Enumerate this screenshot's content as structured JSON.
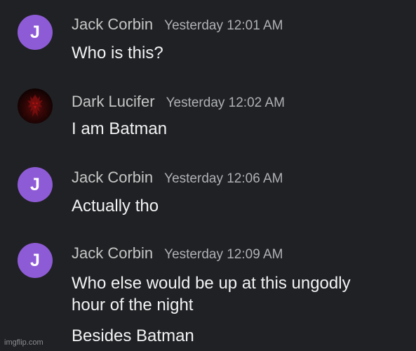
{
  "messages": [
    {
      "avatar_letter": "J",
      "avatar_color": "#8e5bd6",
      "name": "Jack Corbin",
      "time": "Yesterday 12:01 AM",
      "lines": [
        "Who is this?"
      ]
    },
    {
      "avatar_icon": "demon-figure-icon",
      "name": "Dark Lucifer",
      "time": "Yesterday 12:02 AM",
      "lines": [
        "I am Batman"
      ]
    },
    {
      "avatar_letter": "J",
      "avatar_color": "#8e5bd6",
      "name": "Jack Corbin",
      "time": "Yesterday 12:06 AM",
      "lines": [
        "Actually tho"
      ]
    },
    {
      "avatar_letter": "J",
      "avatar_color": "#8e5bd6",
      "name": "Jack Corbin",
      "time": "Yesterday 12:09 AM",
      "lines": [
        "Who else would be up at this ungodly",
        "hour of the night",
        "Besides Batman"
      ]
    }
  ],
  "watermark": "imgflip.com",
  "colors": {
    "background": "#202124",
    "text": "#f1f3f4",
    "name": "#c4c7c5",
    "timestamp": "#aeb1b5"
  }
}
